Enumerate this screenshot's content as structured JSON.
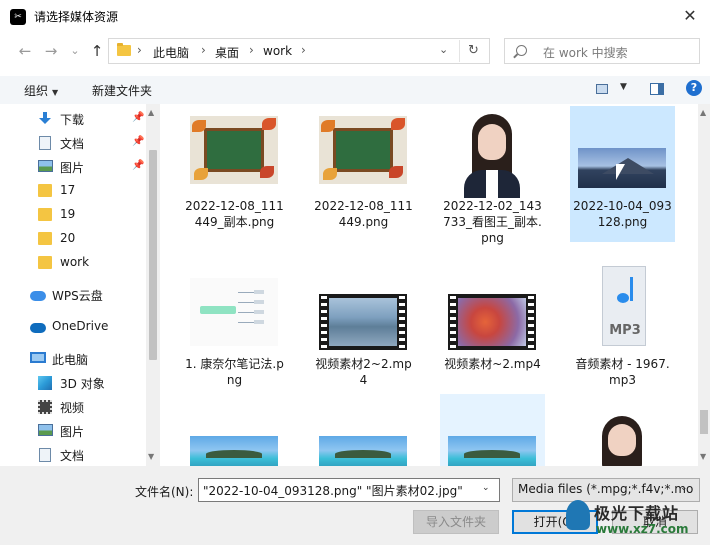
{
  "window": {
    "title": "请选择媒体资源",
    "close_glyph": "✕"
  },
  "nav": {
    "back": "←",
    "forward": "→",
    "recent": "⌄",
    "up": "↑",
    "breadcrumb": [
      "此电脑",
      "桌面",
      "work"
    ],
    "crumb_sep": "›",
    "dropdown_glyph": "⌄",
    "refresh_glyph": "↻",
    "search_placeholder": "在 work 中搜索"
  },
  "toolbar": {
    "organize": "组织",
    "new_folder": "新建文件夹",
    "caret": "▼",
    "help": "?"
  },
  "sidebar": {
    "items": [
      {
        "label": "下载",
        "icon": "download-icon",
        "pinned": true
      },
      {
        "label": "文档",
        "icon": "document-icon",
        "pinned": true
      },
      {
        "label": "图片",
        "icon": "picture-icon",
        "pinned": true
      },
      {
        "label": "17",
        "icon": "folder-icon"
      },
      {
        "label": "19",
        "icon": "folder-icon"
      },
      {
        "label": "20",
        "icon": "folder-icon"
      },
      {
        "label": "work",
        "icon": "folder-icon"
      },
      {
        "label": "WPS云盘",
        "icon": "wps-cloud-icon"
      },
      {
        "label": "OneDrive",
        "icon": "onedrive-icon"
      },
      {
        "label": "此电脑",
        "icon": "computer-icon"
      },
      {
        "label": "3D 对象",
        "icon": "3d-objects-icon"
      },
      {
        "label": "视频",
        "icon": "video-icon"
      },
      {
        "label": "图片",
        "icon": "picture-icon"
      },
      {
        "label": "文档",
        "icon": "document-icon"
      }
    ],
    "pin_glyph": "📌",
    "scroll_up": "▲",
    "scroll_down": "▼"
  },
  "files": [
    {
      "name": "2022-12-08_111449_副本.png",
      "kind": "chalkboard"
    },
    {
      "name": "2022-12-08_111449.png",
      "kind": "chalkboard"
    },
    {
      "name": "2022-12-02_143733_看图王_副本.png",
      "kind": "portrait"
    },
    {
      "name": "2022-10-04_093128.png",
      "kind": "mountain",
      "selected": true
    },
    {
      "name": "1. 康奈尔笔记法.png",
      "kind": "mindmap"
    },
    {
      "name": "视频素材2~2.mp4",
      "kind": "video-city"
    },
    {
      "name": "视频素材~2.mp4",
      "kind": "video-leaf"
    },
    {
      "name": "音频素材 - 1967.mp3",
      "kind": "mp3"
    },
    {
      "name": "",
      "kind": "beach"
    },
    {
      "name": "",
      "kind": "beach"
    },
    {
      "name": "",
      "kind": "beach",
      "hover": true
    },
    {
      "name": "",
      "kind": "portrait"
    }
  ],
  "mp3_badge": "MP3",
  "bottom": {
    "filename_label": "文件名(N):",
    "filename_value": "\"2022-10-04_093128.png\" \"图片素材02.jpg\"",
    "filter_value": "Media files (*.mpg;*.f4v;*.mo",
    "import_folder": "导入文件夹",
    "open": "打开(O)",
    "cancel": "取消",
    "caret": "⌄"
  },
  "watermark": {
    "text": "极光下载站",
    "url": "www.xz7.com"
  },
  "colors": {
    "selection": "#cce8ff",
    "accent": "#0078d7"
  }
}
